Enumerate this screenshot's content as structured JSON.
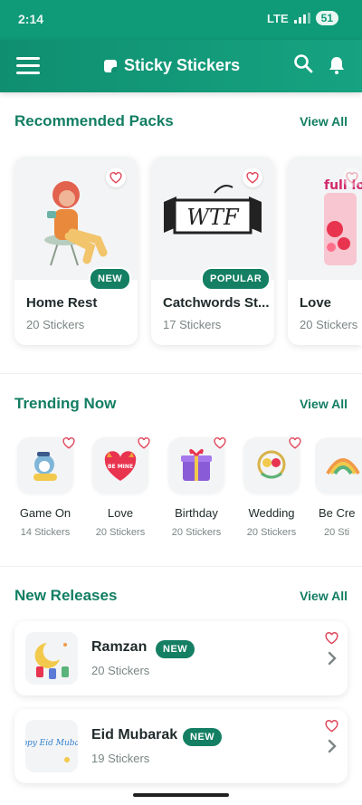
{
  "status_bar": {
    "time": "2:14",
    "network": "LTE",
    "battery": "51"
  },
  "app_bar": {
    "title": "Sticky Stickers"
  },
  "recommended": {
    "title": "Recommended Packs",
    "view_all": "View All",
    "packs": [
      {
        "name": "Home Rest",
        "count": "20 Stickers",
        "badge": "NEW"
      },
      {
        "name": "Catchwords St...",
        "count": "17 Stickers",
        "badge": "POPULAR",
        "art_text": "WTF"
      },
      {
        "name": "Love",
        "count": "20 Stickers",
        "art_text": "full love"
      }
    ]
  },
  "trending": {
    "title": "Trending Now",
    "view_all": "View All",
    "items": [
      {
        "name": "Game On",
        "count": "14 Stickers"
      },
      {
        "name": "Love",
        "count": "20 Stickers",
        "art_text": "BE MINE"
      },
      {
        "name": "Birthday",
        "count": "20 Stickers"
      },
      {
        "name": "Wedding",
        "count": "20 Stickers"
      },
      {
        "name": "Be Cre",
        "count": "20 Sti"
      }
    ]
  },
  "new_releases": {
    "title": "New Releases",
    "view_all": "View All",
    "items": [
      {
        "name": "Ramzan",
        "count": "20 Stickers",
        "badge": "NEW"
      },
      {
        "name": "Eid Mubarak",
        "count": "19 Stickers",
        "badge": "NEW",
        "art_text": "Happy Eid Mubarak"
      }
    ]
  },
  "colors": {
    "primary": "#0f9a78",
    "accent_text": "#127e63",
    "badge": "#147f63",
    "heart": "#e0465a"
  },
  "icons": [
    "menu-icon",
    "sticker-logo-icon",
    "search-icon",
    "bell-icon",
    "heart-icon",
    "chevron-right-icon"
  ]
}
